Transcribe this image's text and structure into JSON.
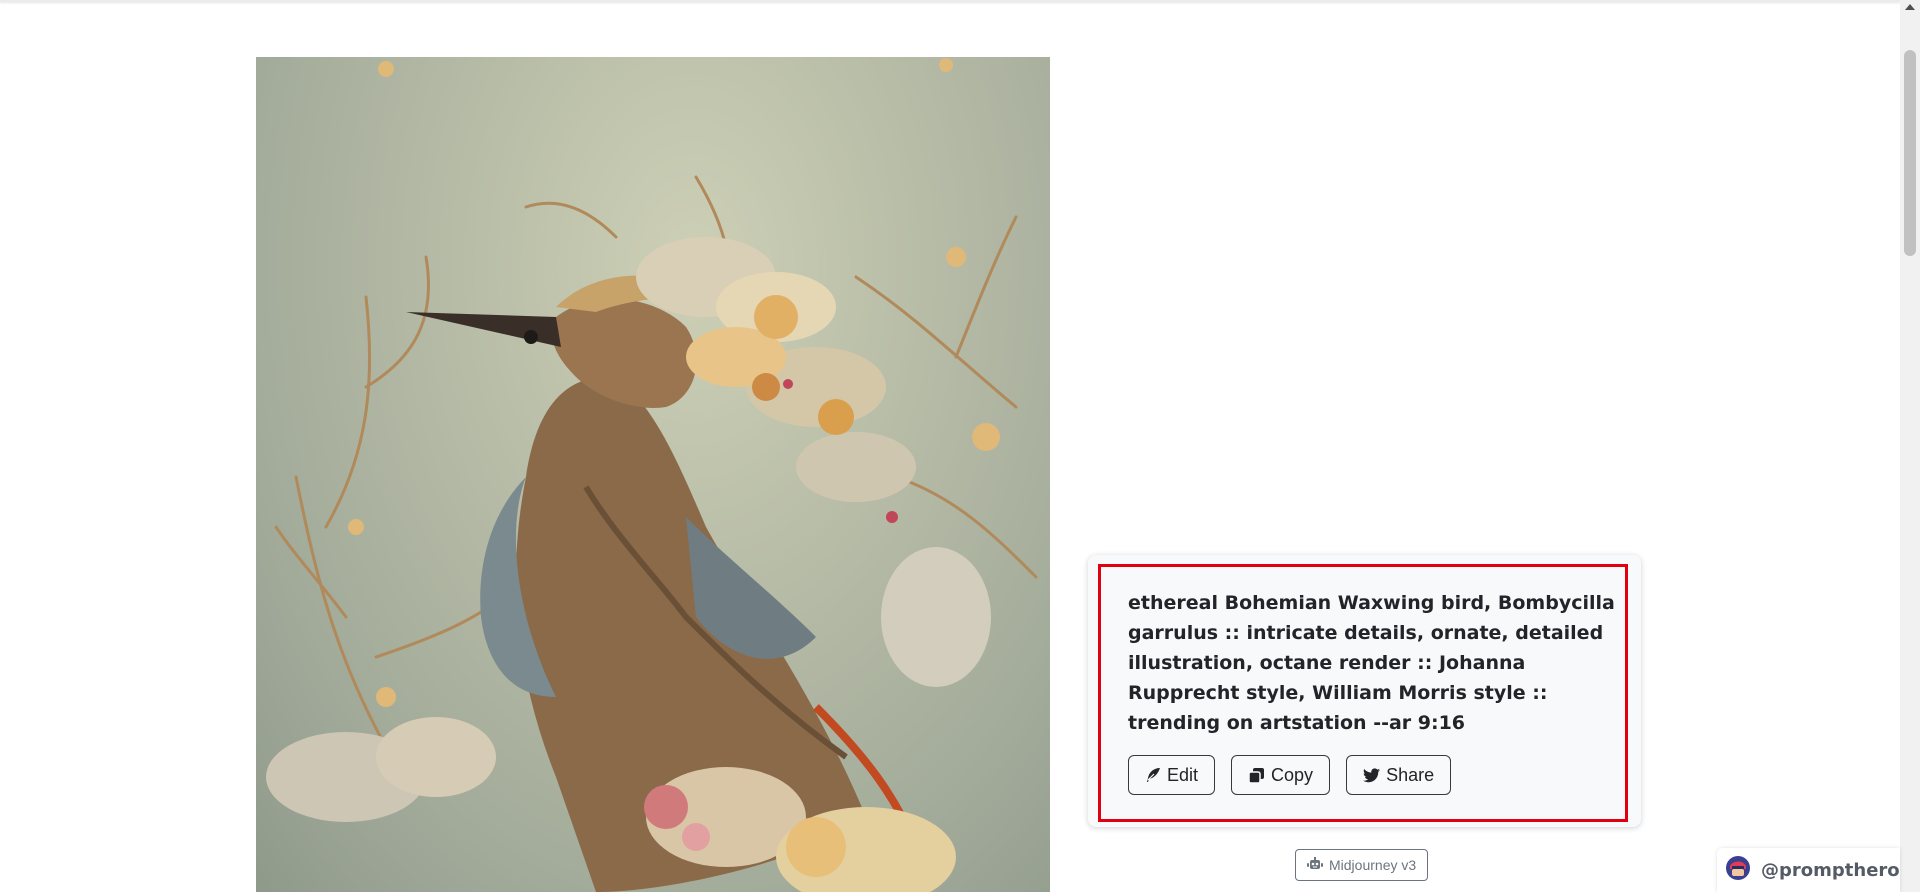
{
  "prompt": {
    "text": "ethereal Bohemian Waxwing bird, Bombycilla garrulus :: intricate details, ornate, detailed illustration, octane render :: Johanna Rupprecht style, William Morris style :: trending on artstation --ar 9:16"
  },
  "actions": {
    "edit_label": "Edit",
    "copy_label": "Copy",
    "share_label": "Share"
  },
  "model": {
    "label": "Midjourney v3"
  },
  "brand": {
    "handle": "@prompthero"
  },
  "icons": {
    "edit": "feather-icon",
    "copy": "copy-icon",
    "share": "twitter-icon",
    "model": "robot-icon",
    "brand": "prompthero-logo-icon"
  },
  "colors": {
    "highlight": "#e10010",
    "text": "#212529",
    "muted": "#6c757d"
  }
}
